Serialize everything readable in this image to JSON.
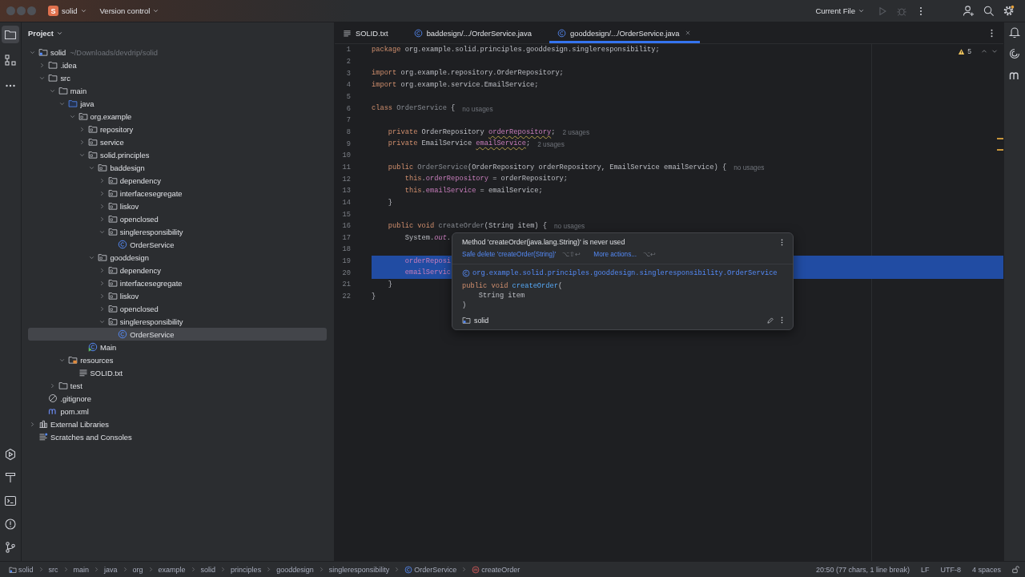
{
  "title_bar": {
    "project_badge": "S",
    "project": "solid",
    "vcs": "Version control",
    "run_config": "Current File"
  },
  "left_toolbar": [
    {
      "kind": "project",
      "selected": true
    },
    {
      "kind": "structure",
      "selected": false
    },
    {
      "kind": "more",
      "selected": false
    },
    {
      "kind": "services",
      "selected": false
    },
    {
      "kind": "build",
      "selected": false
    },
    {
      "kind": "terminal",
      "selected": false
    },
    {
      "kind": "problems",
      "selected": false
    },
    {
      "kind": "git",
      "selected": false
    }
  ],
  "project_panel": {
    "title": "Project",
    "tree": [
      {
        "label": "solid",
        "hint": "~/Downloads/devdrip/solid",
        "kind": "module",
        "expanded": true,
        "selected": false,
        "children": [
          {
            "label": ".idea",
            "kind": "folder",
            "expanded": false,
            "selected": false
          },
          {
            "label": "src",
            "kind": "folder",
            "expanded": true,
            "selected": false,
            "children": [
              {
                "label": "main",
                "kind": "folder",
                "expanded": true,
                "selected": false,
                "children": [
                  {
                    "label": "java",
                    "kind": "source",
                    "expanded": true,
                    "selected": false,
                    "children": [
                      {
                        "label": "org.example",
                        "kind": "package",
                        "expanded": true,
                        "selected": false,
                        "children": [
                          {
                            "label": "repository",
                            "kind": "package",
                            "expanded": false,
                            "selected": false
                          },
                          {
                            "label": "service",
                            "kind": "package",
                            "expanded": false,
                            "selected": false
                          },
                          {
                            "label": "solid.principles",
                            "kind": "package",
                            "expanded": true,
                            "selected": false,
                            "children": [
                              {
                                "label": "baddesign",
                                "kind": "package",
                                "expanded": true,
                                "selected": false,
                                "children": [
                                  {
                                    "label": "dependency",
                                    "kind": "package",
                                    "expanded": false,
                                    "selected": false
                                  },
                                  {
                                    "label": "interfacesegregate",
                                    "kind": "package",
                                    "expanded": false,
                                    "selected": false
                                  },
                                  {
                                    "label": "liskov",
                                    "kind": "package",
                                    "expanded": false,
                                    "selected": false
                                  },
                                  {
                                    "label": "openclosed",
                                    "kind": "package",
                                    "expanded": false,
                                    "selected": false
                                  },
                                  {
                                    "label": "singleresponsibility",
                                    "kind": "package",
                                    "expanded": true,
                                    "selected": false,
                                    "children": [
                                      {
                                        "label": "OrderService",
                                        "kind": "class",
                                        "selected": false
                                      }
                                    ]
                                  }
                                ]
                              },
                              {
                                "label": "gooddesign",
                                "kind": "package",
                                "expanded": true,
                                "selected": false,
                                "children": [
                                  {
                                    "label": "dependency",
                                    "kind": "package",
                                    "expanded": false,
                                    "selected": false
                                  },
                                  {
                                    "label": "interfacesegregate",
                                    "kind": "package",
                                    "expanded": false,
                                    "selected": false
                                  },
                                  {
                                    "label": "liskov",
                                    "kind": "package",
                                    "expanded": false,
                                    "selected": false
                                  },
                                  {
                                    "label": "openclosed",
                                    "kind": "package",
                                    "expanded": false,
                                    "selected": false
                                  },
                                  {
                                    "label": "singleresponsibility",
                                    "kind": "package",
                                    "expanded": true,
                                    "selected": false,
                                    "children": [
                                      {
                                        "label": "OrderService",
                                        "kind": "class",
                                        "selected": true
                                      }
                                    ]
                                  }
                                ]
                              }
                            ]
                          },
                          {
                            "label": "Main",
                            "kind": "main",
                            "selected": false
                          }
                        ]
                      }
                    ]
                  },
                  {
                    "label": "resources",
                    "kind": "resources",
                    "expanded": true,
                    "selected": false,
                    "children": [
                      {
                        "label": "SOLID.txt",
                        "kind": "text",
                        "selected": false
                      }
                    ]
                  }
                ]
              },
              {
                "label": "test",
                "kind": "folder",
                "expanded": false,
                "selected": false
              }
            ]
          },
          {
            "label": ".gitignore",
            "kind": "ignore",
            "selected": false
          },
          {
            "label": "pom.xml",
            "kind": "maven",
            "selected": false
          }
        ]
      },
      {
        "label": "External Libraries",
        "kind": "libraries",
        "expanded": false,
        "selected": false
      },
      {
        "label": "Scratches and Consoles",
        "kind": "scratches",
        "selected": false
      }
    ]
  },
  "editor": {
    "tabs": [
      {
        "label": "SOLID.txt",
        "kind": "text",
        "selected": false
      },
      {
        "label": "baddesign/.../OrderService.java",
        "kind": "class",
        "selected": false
      },
      {
        "label": "gooddesign/.../OrderService.java",
        "kind": "class",
        "selected": true
      }
    ],
    "problems": "5",
    "lines": [
      {
        "number": "1",
        "selected": false,
        "tokens": [
          {
            "kind": "kw",
            "text": "package "
          },
          {
            "kind": "plain",
            "text": "org.example.solid.principles.gooddesign.singleresponsibility;"
          }
        ]
      },
      {
        "number": "2",
        "selected": false
      },
      {
        "number": "3",
        "selected": false,
        "tokens": [
          {
            "kind": "kw",
            "text": "import "
          },
          {
            "kind": "plain",
            "text": "org.example.repository.OrderRepository;"
          }
        ]
      },
      {
        "number": "4",
        "selected": false,
        "tokens": [
          {
            "kind": "kw",
            "text": "import "
          },
          {
            "kind": "plain",
            "text": "org.example.service.EmailService;"
          }
        ]
      },
      {
        "number": "5",
        "selected": false
      },
      {
        "number": "6",
        "selected": false,
        "tokens": [
          {
            "kind": "kw",
            "text": "class "
          },
          {
            "kind": "dim",
            "text": "OrderService"
          },
          {
            "kind": "plain",
            "text": " {"
          }
        ],
        "hint": "no usages"
      },
      {
        "number": "7",
        "selected": false
      },
      {
        "number": "8",
        "selected": false,
        "tokens": [
          {
            "kind": "kw",
            "text": "    private "
          },
          {
            "kind": "plain",
            "text": "OrderRepository "
          },
          {
            "kind": "warn",
            "text": "orderRepository"
          },
          {
            "kind": "plain",
            "text": ";"
          }
        ],
        "hint": "2 usages"
      },
      {
        "number": "9",
        "selected": false,
        "tokens": [
          {
            "kind": "kw",
            "text": "    private "
          },
          {
            "kind": "plain",
            "text": "EmailService "
          },
          {
            "kind": "warn",
            "text": "emailService"
          },
          {
            "kind": "plain",
            "text": ";"
          }
        ],
        "hint": "2 usages"
      },
      {
        "number": "10",
        "selected": false
      },
      {
        "number": "11",
        "selected": false,
        "tokens": [
          {
            "kind": "kw",
            "text": "    public "
          },
          {
            "kind": "dim",
            "text": "OrderService"
          },
          {
            "kind": "plain",
            "text": "(OrderRepository orderRepository, EmailService emailService) {"
          }
        ],
        "hint": "no usages"
      },
      {
        "number": "12",
        "selected": false,
        "tokens": [
          {
            "kind": "kw",
            "text": "        this"
          },
          {
            "kind": "plain",
            "text": "."
          },
          {
            "kind": "field",
            "text": "orderRepository"
          },
          {
            "kind": "plain",
            "text": " = orderRepository;"
          }
        ]
      },
      {
        "number": "13",
        "selected": false,
        "tokens": [
          {
            "kind": "kw",
            "text": "        this"
          },
          {
            "kind": "plain",
            "text": "."
          },
          {
            "kind": "field",
            "text": "emailService"
          },
          {
            "kind": "plain",
            "text": " = emailService;"
          }
        ]
      },
      {
        "number": "14",
        "selected": false,
        "tokens": [
          {
            "kind": "plain",
            "text": "    }"
          }
        ]
      },
      {
        "number": "15",
        "selected": false
      },
      {
        "number": "16",
        "selected": false,
        "tokens": [
          {
            "kind": "kw",
            "text": "    public void "
          },
          {
            "kind": "dim",
            "text": "createOrder"
          },
          {
            "kind": "plain",
            "text": "(String item) {"
          }
        ],
        "hint": "no usages"
      },
      {
        "number": "17",
        "selected": false,
        "tokens": [
          {
            "kind": "plain",
            "text": "        System."
          },
          {
            "kind": "static",
            "text": "out"
          },
          {
            "kind": "plain",
            "text": "."
          }
        ]
      },
      {
        "number": "18",
        "selected": false
      },
      {
        "number": "19",
        "selected": true,
        "tokens": [
          {
            "kind": "field",
            "text": "        orderReposi"
          }
        ]
      },
      {
        "number": "20",
        "selected": true,
        "tokens": [
          {
            "kind": "field",
            "text": "        emailServic"
          }
        ]
      },
      {
        "number": "21",
        "selected": false,
        "tokens": [
          {
            "kind": "plain",
            "text": "    }"
          }
        ]
      },
      {
        "number": "22",
        "selected": false,
        "tokens": [
          {
            "kind": "plain",
            "text": "}"
          }
        ]
      }
    ],
    "popup": {
      "message": "Method 'createOrder(java.lang.String)' is never used",
      "actions": [
        {
          "label": "Safe delete 'createOrder(String)'",
          "shortcut": "⌥⇧↩"
        },
        {
          "label": "More actions...",
          "shortcut": "⌥↩"
        }
      ],
      "qualified_name": "org.example.solid.principles.gooddesign.singleresponsibility.OrderService",
      "signature": [
        [
          {
            "kind": "kw",
            "text": "public void "
          },
          {
            "kind": "fn",
            "text": "createOrder"
          },
          {
            "kind": "plain",
            "text": "("
          }
        ],
        [
          {
            "kind": "plain",
            "text": "    String item"
          }
        ],
        [
          {
            "kind": "plain",
            "text": ")"
          }
        ]
      ],
      "module": "solid"
    }
  },
  "status_bar": {
    "breadcrumbs": [
      {
        "label": "solid",
        "kind": "module"
      },
      {
        "label": "src"
      },
      {
        "label": "main"
      },
      {
        "label": "java"
      },
      {
        "label": "org"
      },
      {
        "label": "example"
      },
      {
        "label": "solid"
      },
      {
        "label": "principles"
      },
      {
        "label": "gooddesign"
      },
      {
        "label": "singleresponsibility"
      },
      {
        "label": "OrderService",
        "kind": "class"
      },
      {
        "label": "createOrder",
        "kind": "method"
      }
    ],
    "position": "20:50 (77 chars, 1 line break)",
    "line_ending": "LF",
    "encoding": "UTF-8",
    "indent": "4 spaces"
  }
}
